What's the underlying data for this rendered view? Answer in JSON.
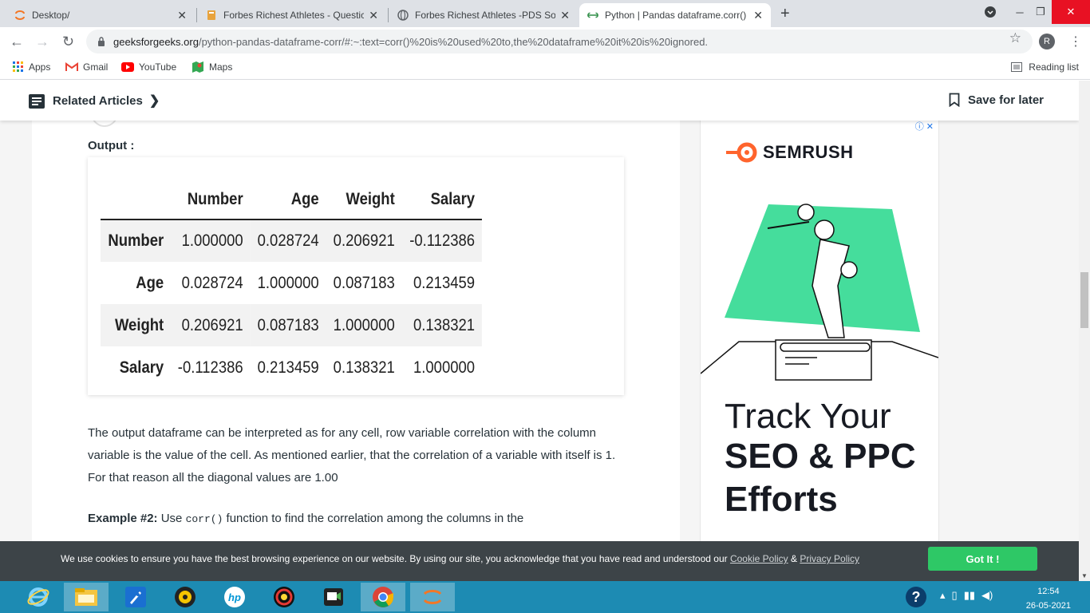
{
  "browser": {
    "tabs": [
      {
        "title": "Desktop/",
        "active": false
      },
      {
        "title": "Forbes Richest Athletes - Questic",
        "active": false
      },
      {
        "title": "Forbes Richest Athletes -PDS Sol",
        "active": false
      },
      {
        "title": "Python | Pandas dataframe.corr()",
        "active": true
      }
    ],
    "url_host": "geeksforgeeks.org",
    "url_path": "/python-pandas-dataframe-corr/#:~:text=corr()%20is%20used%20to,the%20dataframe%20it%20is%20ignored.",
    "profile_initial": "R",
    "bookmarks": [
      "Apps",
      "Gmail",
      "YouTube",
      "Maps"
    ],
    "reading_list": "Reading list"
  },
  "page": {
    "related_articles": "Related Articles",
    "save_for_later": "Save for later",
    "output_label": "Output :",
    "dataframe": {
      "columns": [
        "Number",
        "Age",
        "Weight",
        "Salary"
      ],
      "rows": [
        {
          "index": "Number",
          "values": [
            "1.000000",
            "0.028724",
            "0.206921",
            "-0.112386"
          ]
        },
        {
          "index": "Age",
          "values": [
            "0.028724",
            "1.000000",
            "0.087183",
            "0.213459"
          ]
        },
        {
          "index": "Weight",
          "values": [
            "0.206921",
            "0.087183",
            "1.000000",
            "0.138321"
          ]
        },
        {
          "index": "Salary",
          "values": [
            "-0.112386",
            "0.213459",
            "0.138321",
            "1.000000"
          ]
        }
      ]
    },
    "paragraph": "The output dataframe can be interpreted as for any cell, row variable correlation with the column variable is the value of the cell. As mentioned earlier, that the correlation of a variable with itself is 1. For that reason all the diagonal values are 1.00",
    "example_label": "Example #2:",
    "example_pre": " Use ",
    "example_code": "corr()",
    "example_post": " function to find the correlation among the columns in the"
  },
  "ad": {
    "brand": "SEMRUSH",
    "line1": "Track Your",
    "line2": "SEO & PPC",
    "line3": "Efforts"
  },
  "cookie": {
    "text": "We use cookies to ensure you have the best browsing experience on our website. By using our site, you acknowledge that you have read and understood our ",
    "cookie_policy": "Cookie Policy",
    "amp": " & ",
    "privacy_policy": "Privacy Policy",
    "button": "Got It !"
  },
  "taskbar": {
    "time": "12:54",
    "date": "26-05-2021"
  },
  "colors": {
    "accent_green": "#2ec866",
    "semrush_orange": "#ff642d",
    "taskbar_blue": "#1d8bb3"
  }
}
